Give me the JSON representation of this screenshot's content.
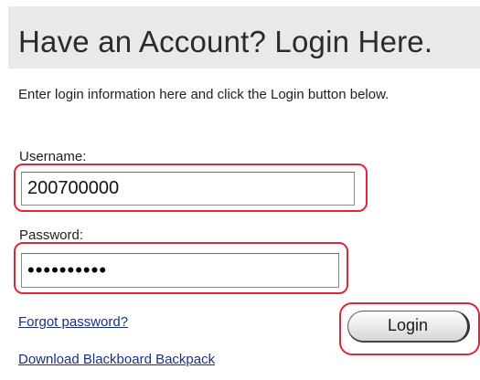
{
  "header": {
    "title": "Have an Account? Login Here."
  },
  "intro": {
    "text": "Enter login information here and click the Login button below."
  },
  "form": {
    "username_label": "Username:",
    "username_value": "200700000",
    "password_label": "Password:",
    "password_value": "••••••••••",
    "login_label": "Login"
  },
  "links": {
    "forgot_password": "Forgot password?",
    "download_backpack": "Download Blackboard Backpack"
  },
  "colors": {
    "highlight": "#e0263a",
    "header_background": "#e9e9e9",
    "link": "#1a2f8a"
  }
}
